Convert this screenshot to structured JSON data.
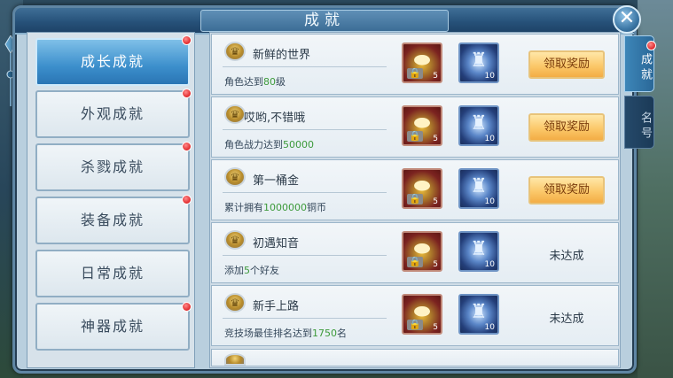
{
  "window": {
    "title": "成就",
    "close_label": "✕"
  },
  "categories": [
    {
      "label": "成长成就",
      "active": true,
      "has_dot": true
    },
    {
      "label": "外观成就",
      "active": false,
      "has_dot": true
    },
    {
      "label": "杀戮成就",
      "active": false,
      "has_dot": true
    },
    {
      "label": "装备成就",
      "active": false,
      "has_dot": true
    },
    {
      "label": "日常成就",
      "active": false,
      "has_dot": false
    },
    {
      "label": "神器成就",
      "active": false,
      "has_dot": true
    }
  ],
  "side_tabs": [
    {
      "label": "成就",
      "active": true,
      "has_dot": true
    },
    {
      "label": "名号",
      "active": false,
      "has_dot": false
    }
  ],
  "rewards": {
    "gold": {
      "icon": "gold-ingot-icon",
      "qty": "5",
      "locked": true
    },
    "armor": {
      "icon": "armor-icon",
      "qty": "10"
    }
  },
  "achievements": [
    {
      "title": "新鲜的世界",
      "desc_pre": "角色达到",
      "desc_hl": "80",
      "desc_post": "级",
      "action": "领取奖励",
      "claimable": true
    },
    {
      "title": "哎哟,不错哦",
      "desc_pre": "角色战力达到",
      "desc_hl": "50000",
      "desc_post": "",
      "action": "领取奖励",
      "claimable": true
    },
    {
      "title": "第一桶金",
      "desc_pre": "累计拥有",
      "desc_hl": "1000000",
      "desc_post": "铜币",
      "action": "领取奖励",
      "claimable": true
    },
    {
      "title": "初遇知音",
      "desc_pre": "添加",
      "desc_hl": "5",
      "desc_post": "个好友",
      "action": "未达成",
      "claimable": false
    },
    {
      "title": "新手上路",
      "desc_pre": "竞技场最佳排名达到",
      "desc_hl": "1750",
      "desc_post": "名",
      "action": "未达成",
      "claimable": false
    }
  ],
  "colors": {
    "highlight": "#3c9a3a",
    "notify_dot": "#e0272a",
    "claim_button": "#fbc86a"
  }
}
